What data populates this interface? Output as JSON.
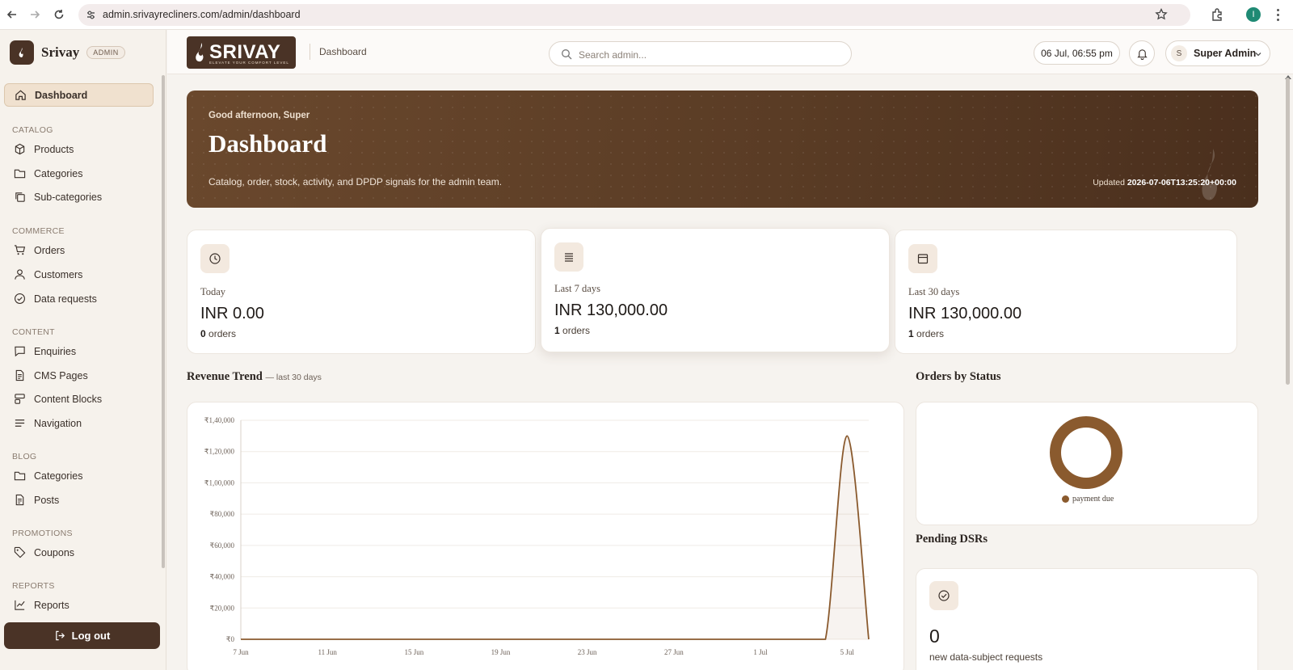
{
  "browser": {
    "url": "admin.srivayrecliners.com/admin/dashboard",
    "profile_initial": "I"
  },
  "brand": {
    "name": "Srivay",
    "badge": "ADMIN",
    "wordmark": "SRIVAY",
    "wordmark_tagline": "ELEVATE YOUR COMFORT LEVEL"
  },
  "sidebar": {
    "dashboard": "Dashboard",
    "sections": {
      "catalog": "CATALOG",
      "commerce": "COMMERCE",
      "content": "CONTENT",
      "blog": "BLOG",
      "promotions": "PROMOTIONS",
      "reports": "REPORTS"
    },
    "items": {
      "products": "Products",
      "categories": "Categories",
      "subcategories": "Sub-categories",
      "orders": "Orders",
      "customers": "Customers",
      "data_requests": "Data requests",
      "enquiries": "Enquiries",
      "cms_pages": "CMS Pages",
      "content_blocks": "Content Blocks",
      "navigation": "Navigation",
      "blog_categories": "Categories",
      "posts": "Posts",
      "coupons": "Coupons",
      "reports": "Reports"
    },
    "logout": "Log out"
  },
  "header": {
    "breadcrumb": "Dashboard",
    "search_placeholder": "Search admin...",
    "datetime": "06 Jul, 06:55 pm",
    "user_initial": "S",
    "user_name": "Super Admin"
  },
  "hero": {
    "greeting": "Good afternoon, Super",
    "title": "Dashboard",
    "description": "Catalog, order, stock, activity, and DPDP signals for the admin team.",
    "updated_label": "Updated",
    "updated_value": "2026-07-06T13:25:20+00:00"
  },
  "stats": [
    {
      "label": "Today",
      "value": "INR 0.00",
      "count": "0",
      "unit": "orders"
    },
    {
      "label": "Last 7 days",
      "value": "INR 130,000.00",
      "count": "1",
      "unit": "orders"
    },
    {
      "label": "Last 30 days",
      "value": "INR 130,000.00",
      "count": "1",
      "unit": "orders"
    }
  ],
  "revenue": {
    "title": "Revenue Trend",
    "subtitle": "— last 30 days"
  },
  "orders_status": {
    "title": "Orders by Status",
    "legend": "payment due"
  },
  "dsr": {
    "title": "Pending DSRs",
    "count": "0",
    "label": "new data-subject requests"
  },
  "colors": {
    "brand": "#4a3326",
    "accent": "#8a5a2e"
  },
  "chart_data": [
    {
      "type": "area",
      "x": [
        "7 Jun",
        "8 Jun",
        "9 Jun",
        "10 Jun",
        "11 Jun",
        "12 Jun",
        "13 Jun",
        "14 Jun",
        "15 Jun",
        "16 Jun",
        "17 Jun",
        "18 Jun",
        "19 Jun",
        "20 Jun",
        "21 Jun",
        "22 Jun",
        "23 Jun",
        "24 Jun",
        "25 Jun",
        "26 Jun",
        "27 Jun",
        "28 Jun",
        "29 Jun",
        "30 Jun",
        "1 Jul",
        "2 Jul",
        "3 Jul",
        "4 Jul",
        "5 Jul",
        "6 Jul"
      ],
      "x_ticks": [
        "7 Jun",
        "11 Jun",
        "15 Jun",
        "19 Jun",
        "23 Jun",
        "27 Jun",
        "1 Jul",
        "5 Jul"
      ],
      "values": [
        0,
        0,
        0,
        0,
        0,
        0,
        0,
        0,
        0,
        0,
        0,
        0,
        0,
        0,
        0,
        0,
        0,
        0,
        0,
        0,
        0,
        0,
        0,
        0,
        0,
        0,
        0,
        0,
        130000,
        0
      ],
      "y_ticks": [
        "₹0",
        "₹20,000",
        "₹40,000",
        "₹60,000",
        "₹80,000",
        "₹1,00,000",
        "₹1,20,000",
        "₹1,40,000"
      ],
      "ylim": [
        0,
        140000
      ],
      "grid": true
    },
    {
      "type": "pie",
      "labels": [
        "payment due"
      ],
      "values": [
        1
      ]
    }
  ]
}
